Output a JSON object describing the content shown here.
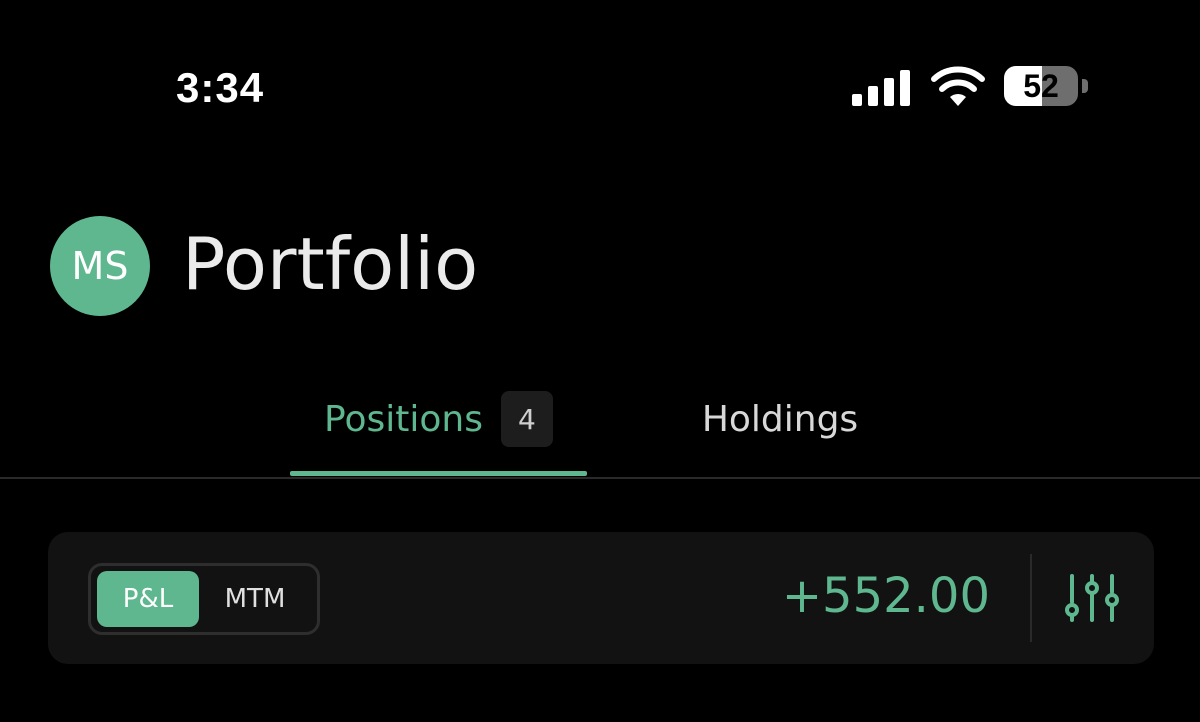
{
  "status_bar": {
    "time": "3:34",
    "battery_level": "52",
    "icons": [
      "signal-icon",
      "wifi-icon",
      "battery-icon"
    ]
  },
  "header": {
    "avatar_initials": "MS",
    "title": "Portfolio"
  },
  "tabs": [
    {
      "label": "Positions",
      "count": "4",
      "active": true
    },
    {
      "label": "Holdings",
      "active": false
    }
  ],
  "summary": {
    "toggle": {
      "options": [
        "P&L",
        "MTM"
      ],
      "selected": "P&L"
    },
    "value": "+552.00",
    "filter_icon": "sliders-icon"
  },
  "colors": {
    "accent": "#5fb78f",
    "background": "#000000",
    "card": "#121212"
  }
}
